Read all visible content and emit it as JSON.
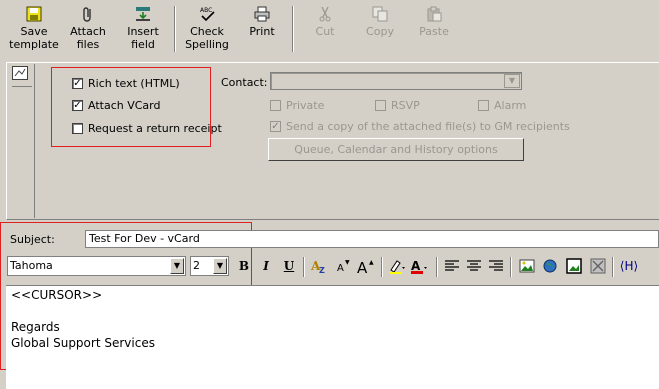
{
  "toolbar": {
    "save_template": "Save\ntemplate",
    "save_template_l1": "Save",
    "save_template_l2": "template",
    "attach_l1": "Attach",
    "attach_l2": "files",
    "insert_l1": "Insert",
    "insert_l2": "field",
    "check_l1": "Check",
    "check_l2": "Spelling",
    "print": "Print",
    "cut": "Cut",
    "copy": "Copy",
    "paste": "Paste"
  },
  "options": {
    "rich_text": {
      "label": "Rich text (HTML)",
      "checked": true
    },
    "attach_vcard": {
      "label": "Attach VCard",
      "checked": true
    },
    "return_receipt": {
      "label": "Request a return receipt",
      "checked": false
    },
    "contact_label": "Contact:",
    "contact_value": "",
    "private": "Private",
    "rsvp": "RSVP",
    "alarm": "Alarm",
    "send_copy": "Send a copy of the attached file(s) to GM recipients",
    "queue_button": "Queue, Calendar and History options"
  },
  "subject": {
    "label": "Subject:",
    "value": "Test For Dev - vCard"
  },
  "format_bar": {
    "font": "Tahoma",
    "size": "2",
    "bold": "B",
    "italic": "I",
    "underline": "U",
    "html_tag": "⟨H⟩"
  },
  "body": {
    "lines": [
      "<<CURSOR>>",
      "",
      "Regards",
      "Global Support Services"
    ]
  },
  "colors": {
    "highlight_box": "#e02020",
    "chrome": "#d4d0c8",
    "disabled_text": "#9a978f"
  }
}
